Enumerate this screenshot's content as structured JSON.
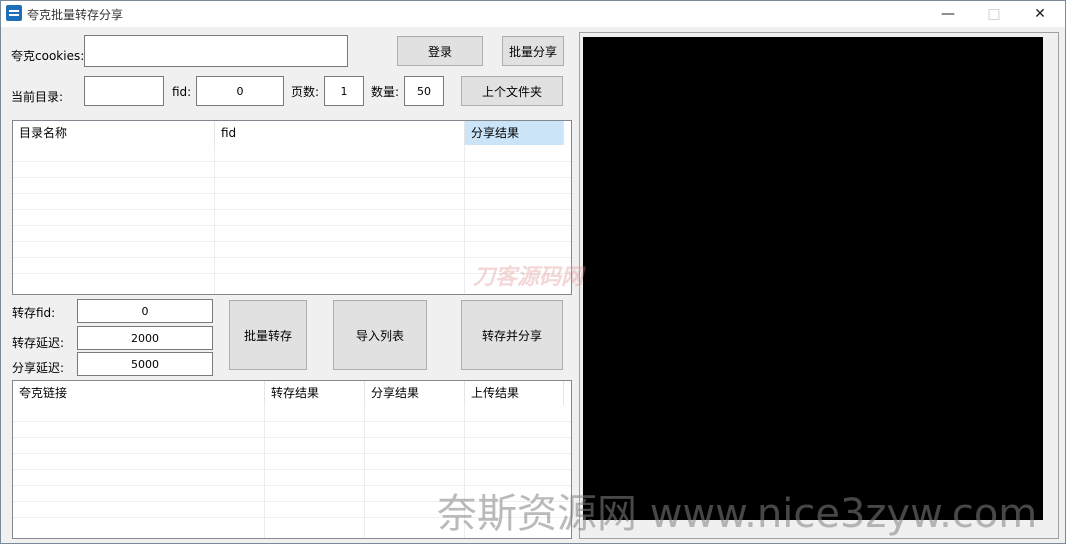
{
  "window": {
    "title": "夸克批量转存分享"
  },
  "top": {
    "cookies_label": "夸克cookies:",
    "cookies_value": "",
    "login_button": "登录",
    "batch_share_button": "批量分享",
    "current_dir_label": "当前目录:",
    "current_dir_value": "",
    "fid_label": "fid:",
    "fid_value": "0",
    "pages_label": "页数:",
    "pages_value": "1",
    "count_label": "数量:",
    "count_value": "50",
    "parent_folder_button": "上个文件夹"
  },
  "dir_table": {
    "columns": [
      "目录名称",
      "fid",
      "分享结果"
    ]
  },
  "middle": {
    "transfer_fid_label": "转存fid:",
    "transfer_fid_value": "0",
    "transfer_delay_label": "转存延迟:",
    "transfer_delay_value": "2000",
    "share_delay_label": "分享延迟:",
    "share_delay_value": "5000",
    "batch_transfer_button": "批量转存",
    "import_list_button": "导入列表",
    "transfer_share_button": "转存并分享"
  },
  "link_table": {
    "columns": [
      "夸克链接",
      "转存结果",
      "分享结果",
      "上传结果"
    ]
  },
  "watermarks": {
    "center": "刀客源码网",
    "bottom": "奈斯资源网 www.nice3zyw.com"
  },
  "icons": {
    "app": "app-logo-icon",
    "minimize": "minimize-icon",
    "maximize": "maximize-icon",
    "close": "close-icon"
  }
}
